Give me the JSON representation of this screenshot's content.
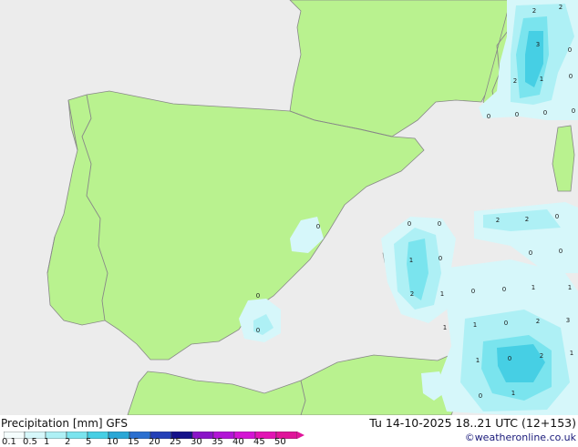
{
  "map": {
    "land_color": "#b9f28f",
    "sea_color": "#ececec",
    "border_color": "#888888",
    "precip_labels": [
      {
        "id": "1",
        "text": "2"
      },
      {
        "id": "2",
        "text": "2"
      },
      {
        "id": "3",
        "text": "3"
      },
      {
        "id": "4",
        "text": "2"
      },
      {
        "id": "5",
        "text": "1"
      },
      {
        "id": "6",
        "text": "0"
      },
      {
        "id": "7",
        "text": "0"
      },
      {
        "id": "8",
        "text": "0"
      },
      {
        "id": "9",
        "text": "0"
      },
      {
        "id": "10",
        "text": "0"
      },
      {
        "id": "11",
        "text": "0"
      },
      {
        "id": "12",
        "text": "0"
      },
      {
        "id": "13",
        "text": "0"
      },
      {
        "id": "14",
        "text": "0"
      },
      {
        "id": "15",
        "text": "2"
      },
      {
        "id": "16",
        "text": "2"
      },
      {
        "id": "17",
        "text": "0"
      },
      {
        "id": "18",
        "text": "0"
      },
      {
        "id": "19",
        "text": "0"
      },
      {
        "id": "20",
        "text": "1"
      },
      {
        "id": "21",
        "text": "0"
      },
      {
        "id": "22",
        "text": "2"
      },
      {
        "id": "23",
        "text": "1"
      },
      {
        "id": "24",
        "text": "0"
      },
      {
        "id": "25",
        "text": "0"
      },
      {
        "id": "26",
        "text": "1"
      },
      {
        "id": "27",
        "text": "1"
      },
      {
        "id": "28",
        "text": "0"
      },
      {
        "id": "29",
        "text": "0"
      },
      {
        "id": "30",
        "text": "1"
      },
      {
        "id": "31",
        "text": "1"
      },
      {
        "id": "32",
        "text": "0"
      },
      {
        "id": "33",
        "text": "2"
      },
      {
        "id": "34",
        "text": "3"
      },
      {
        "id": "35",
        "text": "1"
      },
      {
        "id": "36",
        "text": "0"
      },
      {
        "id": "37",
        "text": "2"
      },
      {
        "id": "38",
        "text": "1"
      },
      {
        "id": "39",
        "text": "0"
      },
      {
        "id": "40",
        "text": "1"
      }
    ]
  },
  "legend": {
    "title": "Precipitation [mm]  GFS",
    "run_info": "Tu 14-10-2025 18..21 UTC (12+153)",
    "copyright": "©weatheronline.co.uk",
    "scale": [
      {
        "label": "0.1",
        "color": "#f4fdfd"
      },
      {
        "label": "0.5",
        "color": "#d6f7fa"
      },
      {
        "label": "1",
        "color": "#aef0f5"
      },
      {
        "label": "2",
        "color": "#7ae4ee"
      },
      {
        "label": "5",
        "color": "#46cfe4"
      },
      {
        "label": "10",
        "color": "#2aa7d6"
      },
      {
        "label": "15",
        "color": "#2a6fd0"
      },
      {
        "label": "20",
        "color": "#2440b8"
      },
      {
        "label": "25",
        "color": "#14128a"
      },
      {
        "label": "30",
        "color": "#8a14c8"
      },
      {
        "label": "35",
        "color": "#b214d6"
      },
      {
        "label": "40",
        "color": "#d414d4"
      },
      {
        "label": "45",
        "color": "#e214b4"
      },
      {
        "label": "50",
        "color": "#e0149a"
      }
    ]
  }
}
